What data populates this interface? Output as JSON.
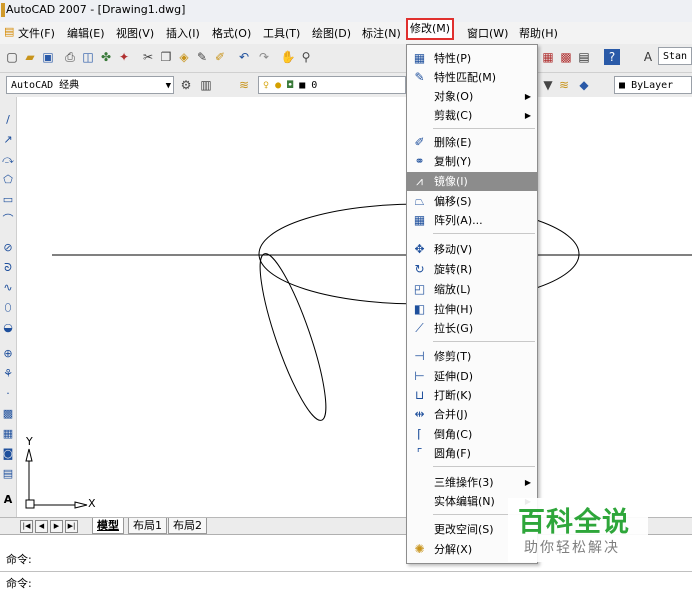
{
  "window": {
    "title": "AutoCAD 2007 - [Drawing1.dwg]"
  },
  "menubar": [
    {
      "label": "文件(F)"
    },
    {
      "label": "编辑(E)"
    },
    {
      "label": "视图(V)"
    },
    {
      "label": "插入(I)"
    },
    {
      "label": "格式(O)"
    },
    {
      "label": "工具(T)"
    },
    {
      "label": "绘图(D)"
    },
    {
      "label": "标注(N)"
    },
    {
      "label": "修改(M)",
      "active": true
    },
    {
      "label": "窗口(W)"
    },
    {
      "label": "帮助(H)"
    }
  ],
  "toolbar2": {
    "workspace": "AutoCAD 经典",
    "layer": "0",
    "color": "ByLayer",
    "text_style": "Stan"
  },
  "modify_menu": {
    "items": [
      {
        "label": "特性(P)",
        "icon": "properties-icon"
      },
      {
        "label": "特性匹配(M)",
        "icon": "match-properties-icon"
      },
      {
        "label": "对象(O)",
        "submenu": true
      },
      {
        "label": "剪裁(C)",
        "submenu": true
      },
      {
        "separator": true
      },
      {
        "label": "删除(E)",
        "icon": "erase-icon"
      },
      {
        "label": "复制(Y)",
        "icon": "copy-icon"
      },
      {
        "label": "镜像(I)",
        "icon": "mirror-icon",
        "selected": true
      },
      {
        "label": "偏移(S)",
        "icon": "offset-icon"
      },
      {
        "label": "阵列(A)...",
        "icon": "array-icon"
      },
      {
        "separator": true
      },
      {
        "label": "移动(V)",
        "icon": "move-icon"
      },
      {
        "label": "旋转(R)",
        "icon": "rotate-icon"
      },
      {
        "label": "缩放(L)",
        "icon": "scale-icon"
      },
      {
        "label": "拉伸(H)",
        "icon": "stretch-icon"
      },
      {
        "label": "拉长(G)",
        "icon": "lengthen-icon"
      },
      {
        "separator": true
      },
      {
        "label": "修剪(T)",
        "icon": "trim-icon"
      },
      {
        "label": "延伸(D)",
        "icon": "extend-icon"
      },
      {
        "label": "打断(K)",
        "icon": "break-icon"
      },
      {
        "label": "合并(J)",
        "icon": "join-icon"
      },
      {
        "label": "倒角(C)",
        "icon": "chamfer-icon"
      },
      {
        "label": "圆角(F)",
        "icon": "fillet-icon"
      },
      {
        "separator": true
      },
      {
        "label": "三维操作(3)",
        "submenu": true
      },
      {
        "label": "实体编辑(N)",
        "submenu": true
      },
      {
        "separator": true
      },
      {
        "label": "更改空间(S)"
      },
      {
        "label": "分解(X)",
        "icon": "explode-icon"
      }
    ]
  },
  "ucs": {
    "y_label": "Y",
    "x_label": "X"
  },
  "tabs": [
    {
      "label": "模型",
      "active": true
    },
    {
      "label": "布局1"
    },
    {
      "label": "布局2"
    }
  ],
  "command": {
    "line1": "命令:",
    "line2": "命令:"
  },
  "watermark": {
    "title": "百科全说",
    "subtitle": "助你轻松解决"
  },
  "colors": {
    "highlight_border": "#e0302e",
    "arrow": "#e8353c",
    "selected_bg": "#8c8c8c",
    "watermark_green": "#2ea63a"
  }
}
